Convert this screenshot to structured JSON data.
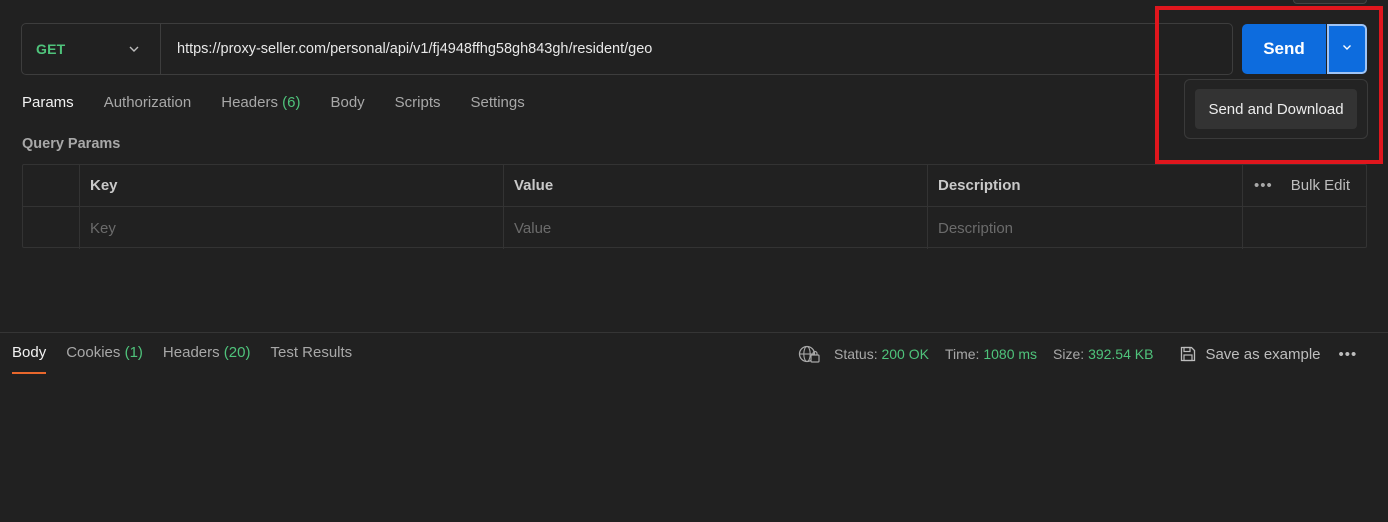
{
  "request": {
    "method": "GET",
    "url": "https://proxy-seller.com/personal/api/v1/fj4948ffhg58gh843gh/resident/geo",
    "send_label": "Send",
    "dropdown_item": "Send and Download"
  },
  "req_tabs": [
    {
      "label": "Params",
      "count": ""
    },
    {
      "label": "Authorization",
      "count": ""
    },
    {
      "label": "Headers",
      "count": "(6)"
    },
    {
      "label": "Body",
      "count": ""
    },
    {
      "label": "Scripts",
      "count": ""
    },
    {
      "label": "Settings",
      "count": ""
    }
  ],
  "params": {
    "section_title": "Query Params",
    "headers": {
      "key": "Key",
      "value": "Value",
      "description": "Description",
      "bulk_edit": "Bulk Edit"
    },
    "placeholders": {
      "key": "Key",
      "value": "Value",
      "description": "Description"
    }
  },
  "resp_tabs": [
    {
      "label": "Body",
      "count": ""
    },
    {
      "label": "Cookies",
      "count": "(1)"
    },
    {
      "label": "Headers",
      "count": "(20)"
    },
    {
      "label": "Test Results",
      "count": ""
    }
  ],
  "response_meta": {
    "status_label": "Status:",
    "status_value": "200 OK",
    "time_label": "Time:",
    "time_value": "1080 ms",
    "size_label": "Size:",
    "size_value": "392.54 KB",
    "save_label": "Save as example",
    "more": "•••"
  },
  "colors": {
    "accent_blue": "#0d6cde",
    "success_green": "#4fc37b",
    "highlight_red": "#e0161d",
    "active_tab_underline": "#e8672c"
  }
}
